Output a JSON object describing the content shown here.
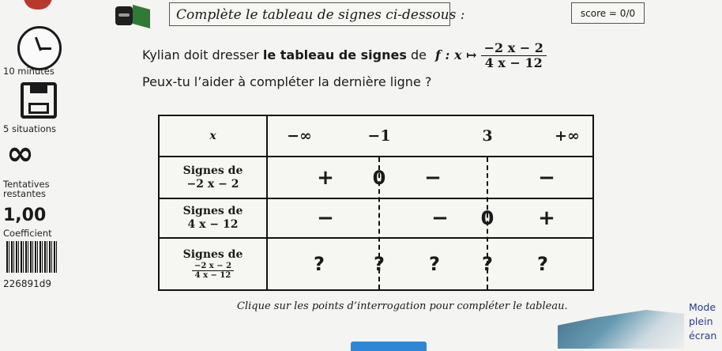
{
  "header": {
    "title": "Complète le tableau de signes ci-dessous :",
    "score": "score = 0/0"
  },
  "sidebar": {
    "time_label": "10 minutes",
    "situations_label": "5 situations",
    "infinity_symbol": "∞",
    "attempts_label_line1": "Tentatives",
    "attempts_label_line2": "restantes",
    "coefficient_value": "1,00",
    "coefficient_label": "Coefficient",
    "id_code": "226891d9"
  },
  "problem": {
    "intro_part1": "Kylian doit dresser ",
    "intro_bold": "le tableau de signes",
    "intro_part2": " de ",
    "function_name": "f : x ↦",
    "numerator": "−2 x − 2",
    "denominator": "4 x − 12",
    "question": "Peux-tu l’aider à compléter la dernière ligne ?"
  },
  "table": {
    "x_header": "x",
    "x_values": [
      "−∞",
      "−1",
      "3",
      "+∞"
    ],
    "rows": [
      {
        "label_line1": "Signes de",
        "label_line2": "−2 x − 2",
        "cells": [
          "+",
          "0",
          "−",
          "",
          "−"
        ]
      },
      {
        "label_line1": "Signes de",
        "label_line2": "4 x − 12",
        "cells": [
          "−",
          "",
          "−",
          "0",
          "+"
        ]
      },
      {
        "label_line1": "Signes de",
        "label_num": "−2 x − 2",
        "label_den": "4 x − 12",
        "cells": [
          "?",
          "?",
          "?",
          "?",
          "?"
        ]
      }
    ]
  },
  "hint": "Clique sur les points d’interrogation pour compléter le tableau.",
  "mode_button": {
    "line1": "Mode",
    "line2": "plein",
    "line3": "écran"
  }
}
